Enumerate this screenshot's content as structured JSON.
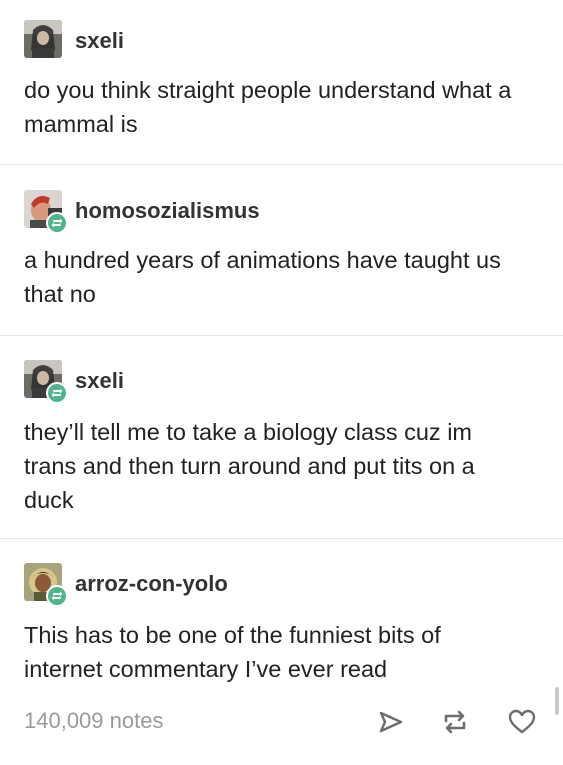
{
  "posts": [
    {
      "username": "sxeli",
      "text": "do you think straight people understand what a mammal is",
      "reblogged": false
    },
    {
      "username": "homosozialismus",
      "text": "a hundred years of animations have taught us that no",
      "reblogged": true
    },
    {
      "username": "sxeli",
      "text": "they’ll tell me to take a biology class cuz im trans and then turn around and put tits on a duck",
      "reblogged": true
    },
    {
      "username": "arroz-con-yolo",
      "text": "This has to be one of the funniest bits of internet commentary I’ve ever read",
      "reblogged": true
    }
  ],
  "footer": {
    "notes": "140,009 notes",
    "actions": [
      "share-icon",
      "reblog-icon",
      "like-icon"
    ]
  },
  "colors": {
    "reblog_badge": "#4fb58a",
    "username": "#333333",
    "text": "#222222",
    "notes": "#9a9a9a",
    "divider": "#e6e6e6"
  }
}
